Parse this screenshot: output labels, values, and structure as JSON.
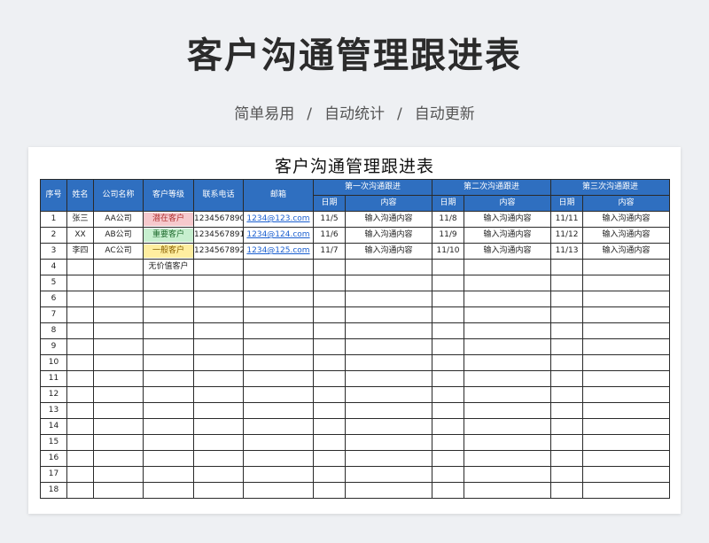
{
  "hero": {
    "title": "客户沟通管理跟进表",
    "subtitle_items": [
      "简单易用",
      "自动统计",
      "自动更新"
    ],
    "separator": "/"
  },
  "sheet": {
    "title": "客户沟通管理跟进表",
    "headers": {
      "seq": "序号",
      "name": "姓名",
      "company": "公司名称",
      "level": "客户等级",
      "phone": "联系电话",
      "email": "邮箱",
      "rounds": [
        "第一次沟通跟进",
        "第二次沟通跟进",
        "第三次沟通跟进"
      ],
      "date": "日期",
      "content": "内容"
    },
    "level_colors": {
      "red": "#f6c9cd",
      "green": "#c7efcf",
      "yellow": "#ffeea0"
    },
    "rows": [
      {
        "seq": "1",
        "name": "张三",
        "company": "AA公司",
        "level": "潜在客户",
        "level_color": "red",
        "phone": "1234567890",
        "email": "1234@123.com",
        "f": [
          {
            "date": "11/5",
            "content": "输入沟通内容"
          },
          {
            "date": "11/8",
            "content": "输入沟通内容"
          },
          {
            "date": "11/11",
            "content": "输入沟通内容"
          }
        ]
      },
      {
        "seq": "2",
        "name": "XX",
        "company": "AB公司",
        "level": "重要客户",
        "level_color": "green",
        "phone": "1234567891",
        "email": "1234@124.com",
        "f": [
          {
            "date": "11/6",
            "content": "输入沟通内容"
          },
          {
            "date": "11/9",
            "content": "输入沟通内容"
          },
          {
            "date": "11/12",
            "content": "输入沟通内容"
          }
        ]
      },
      {
        "seq": "3",
        "name": "李四",
        "company": "AC公司",
        "level": "一般客户",
        "level_color": "yellow",
        "phone": "1234567892",
        "email": "1234@125.com",
        "f": [
          {
            "date": "11/7",
            "content": "输入沟通内容"
          },
          {
            "date": "11/10",
            "content": "输入沟通内容"
          },
          {
            "date": "11/13",
            "content": "输入沟通内容"
          }
        ]
      },
      {
        "seq": "4",
        "level": "无价值客户"
      },
      {
        "seq": "5"
      },
      {
        "seq": "6"
      },
      {
        "seq": "7"
      },
      {
        "seq": "8"
      },
      {
        "seq": "9"
      },
      {
        "seq": "10"
      },
      {
        "seq": "11"
      },
      {
        "seq": "12"
      },
      {
        "seq": "13"
      },
      {
        "seq": "14"
      },
      {
        "seq": "15"
      },
      {
        "seq": "16"
      },
      {
        "seq": "17"
      },
      {
        "seq": "18"
      }
    ]
  }
}
